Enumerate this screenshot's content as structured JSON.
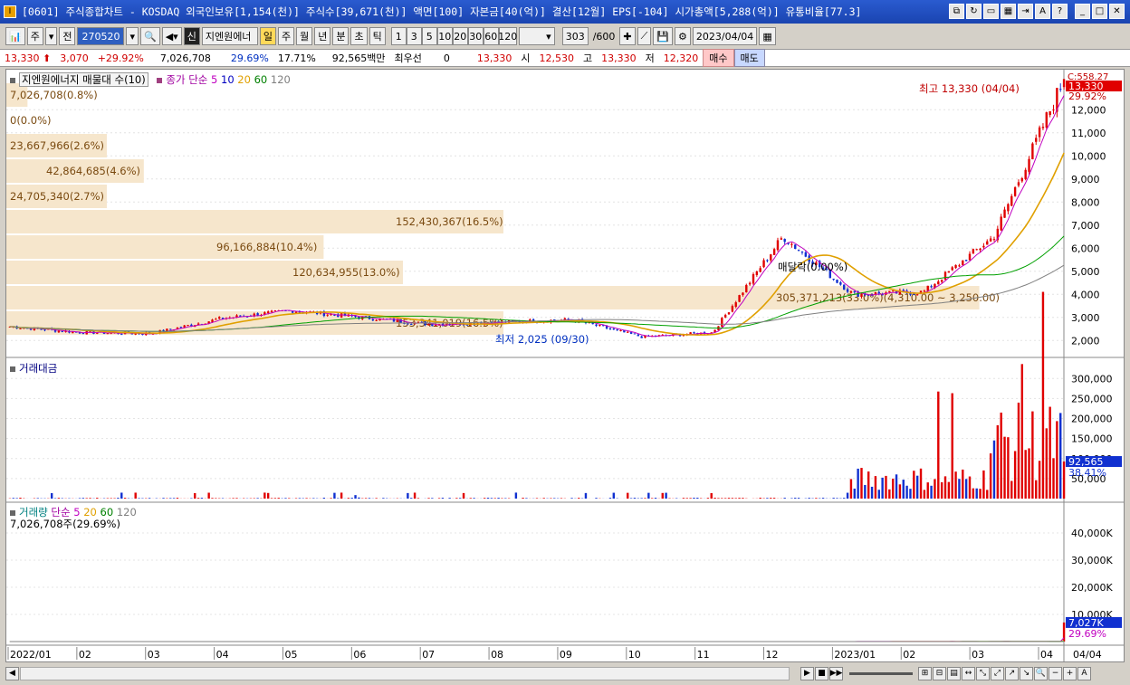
{
  "window": {
    "title": "[0601] 주식종합차트 - KOSDAQ 외국인보유[1,154(천)] 주식수[39,671(천)] 액면[100] 자본금[40(억)] 결산[12월] EPS[-104] 시가총액[5,288(억)] 유통비율[77.3]",
    "app_icon": "I"
  },
  "toolbar": {
    "period_select": "주",
    "prev_label": "전",
    "code_value": "270520",
    "stock_name": "지엔원에너",
    "timeframes": [
      "일",
      "주",
      "월",
      "년",
      "분",
      "초",
      "틱"
    ],
    "selected_timeframe": "일",
    "intervals": [
      "1",
      "3",
      "5",
      "10",
      "20",
      "30",
      "60",
      "120"
    ],
    "count_value": "303",
    "count_total": "/600",
    "date_value": "2023/04/04"
  },
  "quote": {
    "price": "13,330",
    "change": "3,070",
    "change_pct": "+29.92%",
    "volume": "7,026,708",
    "vol_ratio": "29.69%",
    "turnover": "17.71%",
    "amount": "92,565백만",
    "priority_label": "최우선",
    "priority_value": "0",
    "ask": "13,330",
    "open_label": "시",
    "open": "12,530",
    "high_label": "고",
    "high": "13,330",
    "low_label": "저",
    "low": "12,320",
    "buy_label": "매수",
    "sell_label": "매도"
  },
  "price_panel": {
    "legend": "지엔원에너지 매물대 수(10)",
    "ma_label": "종가 단순",
    "ma_periods": [
      "5",
      "10",
      "20",
      "60",
      "120"
    ],
    "profile_labels": [
      "7,026,708(0.8%)",
      "0(0.0%)",
      "23,667,966(2.6%)",
      "42,864,685(4.6%)",
      "24,705,340(2.7%)",
      "152,430,367(16.5%)",
      "96,166,884(10.4%)",
      "120,634,955(13.0%)",
      "305,371,213(33.0%)(4,310.00 ~ 3,250.00)",
      "153,341,019(16.5%)"
    ],
    "high_annotation": "최고 13,330 (04/04)",
    "low_annotation": "최저 2,025 (09/30)",
    "mid_annotation": "매달락(0.00%)",
    "axis_top": "C:558.27",
    "last_price": "13,330",
    "last_pct": "29.92%",
    "y_ticks": [
      "12,000",
      "11,000",
      "10,000",
      "9,000",
      "8,000",
      "7,000",
      "6,000",
      "5,000",
      "4,000",
      "3,000",
      "2,000"
    ]
  },
  "amount_panel": {
    "legend": "거래대금",
    "y_ticks": [
      "300,000",
      "250,000",
      "200,000",
      "150,000",
      "100,000",
      "50,000"
    ],
    "last_value": "92,565",
    "last_pct": "38.41%"
  },
  "volume_panel": {
    "legend": "거래량",
    "ma_label": "단순",
    "ma_periods": [
      "5",
      "20",
      "60",
      "120"
    ],
    "sub_label": "7,026,708주(29.69%)",
    "y_ticks": [
      "40,000K",
      "30,000K",
      "20,000K",
      "10,000K"
    ],
    "last_value": "7,027K",
    "last_pct": "29.69%"
  },
  "x_axis": {
    "labels": [
      "2022/01",
      "02",
      "03",
      "04",
      "05",
      "06",
      "07",
      "08",
      "09",
      "10",
      "11",
      "12",
      "2023/01",
      "02",
      "03",
      "04"
    ],
    "right_label": "04/04"
  },
  "colors": {
    "up": "#e00000",
    "down": "#1030d0",
    "profile": "#f6e6cc",
    "ma5": "#c000c0",
    "ma20": "#e0a000",
    "ma60": "#00a000",
    "ma120": "#808080"
  },
  "chart_data": {
    "type": "line",
    "title": "",
    "x": [
      "2022/01",
      "02",
      "03",
      "04",
      "05",
      "06",
      "07",
      "08",
      "09",
      "10",
      "11",
      "12",
      "2023/01",
      "02",
      "03",
      "04"
    ],
    "series": [
      {
        "name": "",
        "values": [
          2600,
          2350,
          2300,
          2950,
          3300,
          3000,
          2700,
          2800,
          2900,
          2150,
          2350,
          6500,
          4000,
          4100,
          6500,
          13330
        ]
      }
    ],
    "ylim": [
      1500,
      13500
    ],
    "xlabel": "",
    "ylabel": ""
  }
}
